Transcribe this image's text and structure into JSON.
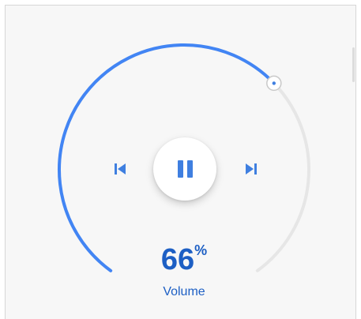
{
  "player": {
    "state": "playing",
    "volume": {
      "value": "66",
      "unit": "%",
      "label": "Volume",
      "fraction": 0.66
    }
  },
  "controls": {
    "prev_icon": "skip-previous-icon",
    "play_pause_icon": "pause-icon",
    "next_icon": "skip-next-icon"
  },
  "colors": {
    "accent": "#4285f4",
    "track": "#e6e6e6",
    "text": "#1d5fc4",
    "background": "#f7f7f7"
  }
}
